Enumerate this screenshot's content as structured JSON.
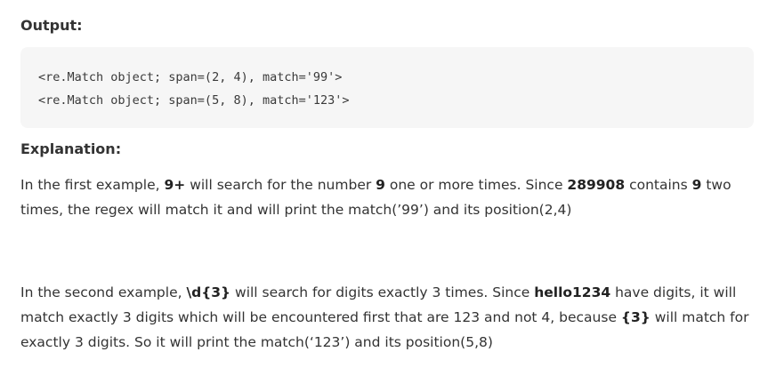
{
  "output": {
    "heading": "Output:",
    "code_lines": [
      "<re.Match object; span=(2, 4), match='99'>",
      "<re.Match object; span=(5, 8), match='123'>"
    ]
  },
  "explanation": {
    "heading": "Explanation:",
    "paragraph1": {
      "t1": "In the first example, ",
      "b1": "9+",
      "t2": " will search for the number ",
      "b2": "9",
      "t3": " one or more times. Since ",
      "b3": "289908",
      "t4": " contains ",
      "b4": "9",
      "t5": " two times, the regex will match it and will print the match(’99’) and its position(2,4)"
    },
    "paragraph2": {
      "t1": "In the second example, ",
      "b1": "\\d{3}",
      "t2": " will search for digits exactly 3 times. Since ",
      "b2": "hello1234",
      "t3": " have digits, it will match exactly 3 digits which will be encountered first that are 123 and not 4, because ",
      "b3": "{3}",
      "t4": " will match for exactly 3 digits. So it will print the match(‘123’) and its position(5,8)"
    }
  }
}
